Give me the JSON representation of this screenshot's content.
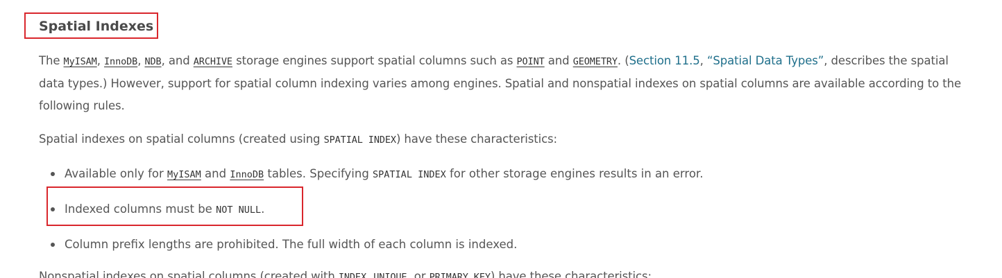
{
  "heading": "Spatial Indexes",
  "paragraph1": {
    "t1": "The ",
    "c1": "MyISAM",
    "t2": ", ",
    "c2": "InnoDB",
    "t3": ", ",
    "c3": "NDB",
    "t4": ", and ",
    "c4": "ARCHIVE",
    "t5": " storage engines support spatial columns such as ",
    "c5": "POINT",
    "t6": " and ",
    "c6": "GEOMETRY",
    "t7": ". (",
    "link1": "Section 11.5",
    "t8": ", ",
    "link2": "“Spatial Data Types”",
    "t9": ", describes the spatial data types.) However, support for spatial column indexing varies among engines. Spatial and nonspatial indexes on spatial columns are available according to the following rules."
  },
  "paragraph2": {
    "t1": "Spatial indexes on spatial columns (created using ",
    "c1": "SPATIAL INDEX",
    "t2": ") have these characteristics:"
  },
  "bullets": [
    {
      "t1": "Available only for ",
      "c1": "MyISAM",
      "t2": " and ",
      "c2": "InnoDB",
      "t3": " tables. Specifying ",
      "c3": "SPATIAL INDEX",
      "t4": " for other storage engines results in an error."
    },
    {
      "t1": "Indexed columns must be ",
      "c1": "NOT NULL",
      "t2": "."
    },
    {
      "t1": "Column prefix lengths are prohibited. The full width of each column is indexed."
    }
  ],
  "paragraph3": {
    "t1": "Nonspatial indexes on spatial columns (created with ",
    "c1": "INDEX",
    "t2": ", ",
    "c2": "UNIQUE",
    "t3": ", or ",
    "c3": "PRIMARY KEY",
    "t4": ") have these characteristics:"
  }
}
